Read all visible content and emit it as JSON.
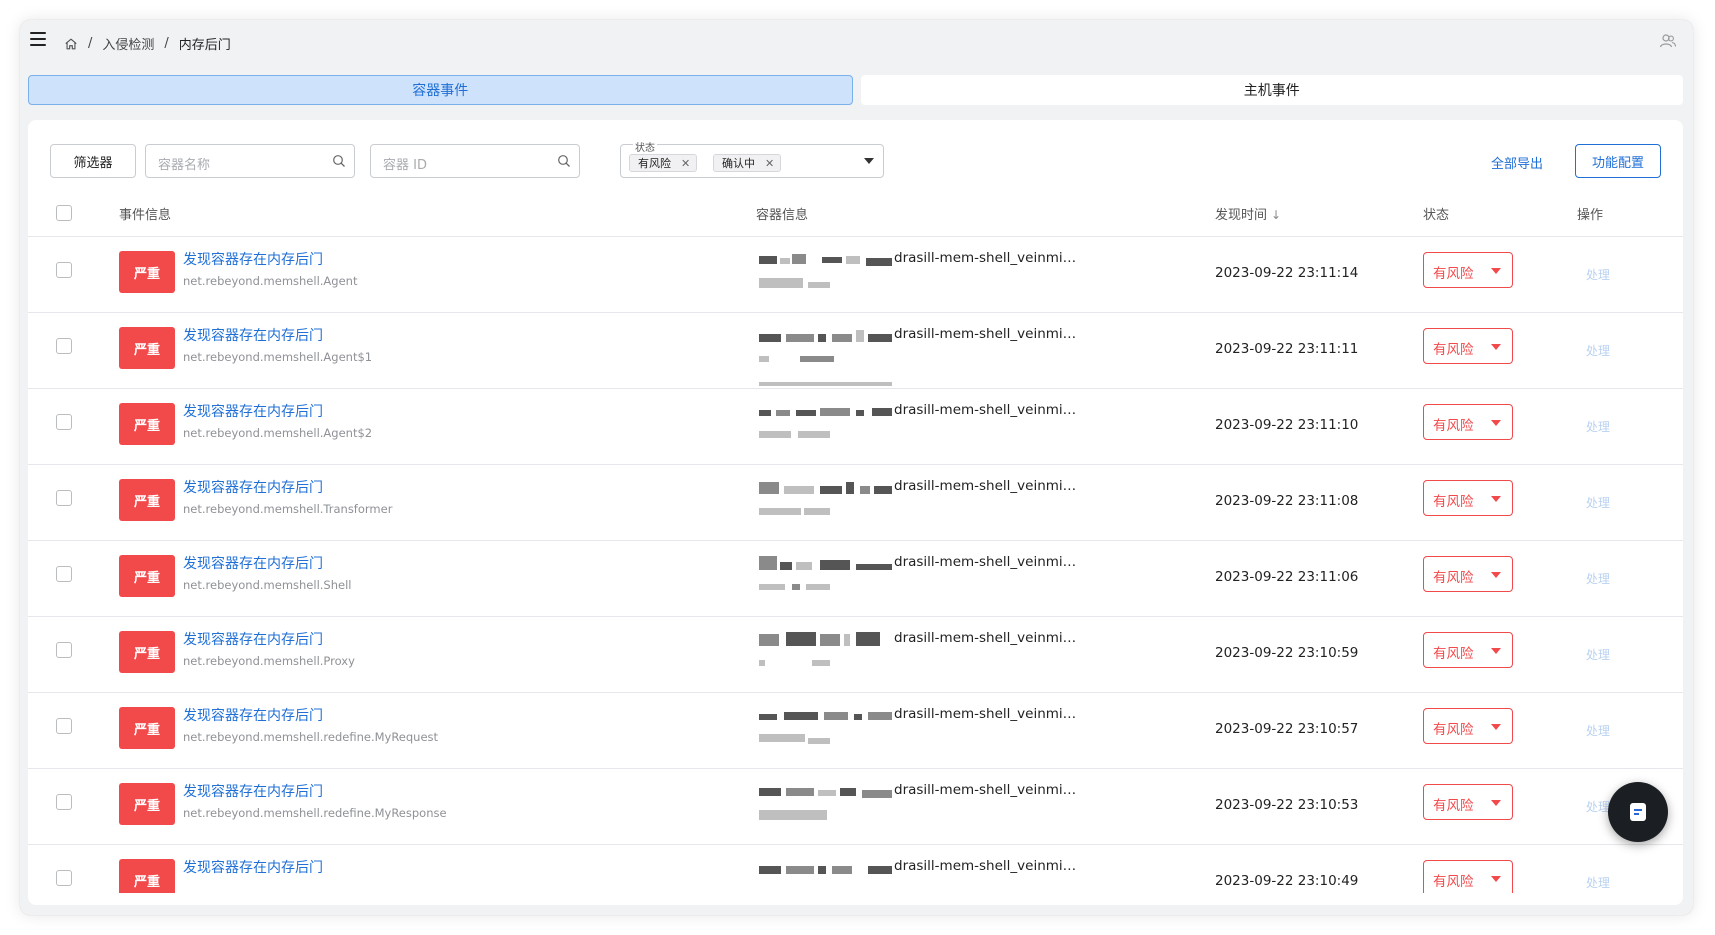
{
  "breadcrumb": {
    "items": [
      "入侵检测",
      "内存后门"
    ]
  },
  "tabs": [
    {
      "label": "容器事件",
      "active": true
    },
    {
      "label": "主机事件",
      "active": false
    }
  ],
  "toolbar": {
    "filter_label": "筛选器",
    "search_name_placeholder": "容器名称",
    "search_id_placeholder": "容器 ID",
    "status_label": "状态",
    "status_chips": [
      "有风险",
      "确认中"
    ],
    "export_label": "全部导出",
    "config_label": "功能配置"
  },
  "table": {
    "headers": {
      "event": "事件信息",
      "container": "容器信息",
      "time": "发现时间",
      "status": "状态",
      "action": "操作"
    },
    "rows": [
      {
        "severity": "严重",
        "title": "发现容器存在内存后门",
        "sub": "net.rebeyond.memshell.Agent",
        "container": "drasill-mem-shell_veinmi…",
        "time": "2023-09-22 23:11:14",
        "status": "有风险",
        "action": "处理"
      },
      {
        "severity": "严重",
        "title": "发现容器存在内存后门",
        "sub": "net.rebeyond.memshell.Agent$1",
        "container": "drasill-mem-shell_veinmi…",
        "time": "2023-09-22 23:11:11",
        "status": "有风险",
        "action": "处理"
      },
      {
        "severity": "严重",
        "title": "发现容器存在内存后门",
        "sub": "net.rebeyond.memshell.Agent$2",
        "container": "drasill-mem-shell_veinmi…",
        "time": "2023-09-22 23:11:10",
        "status": "有风险",
        "action": "处理"
      },
      {
        "severity": "严重",
        "title": "发现容器存在内存后门",
        "sub": "net.rebeyond.memshell.Transformer",
        "container": "drasill-mem-shell_veinmi…",
        "time": "2023-09-22 23:11:08",
        "status": "有风险",
        "action": "处理"
      },
      {
        "severity": "严重",
        "title": "发现容器存在内存后门",
        "sub": "net.rebeyond.memshell.Shell",
        "container": "drasill-mem-shell_veinmi…",
        "time": "2023-09-22 23:11:06",
        "status": "有风险",
        "action": "处理"
      },
      {
        "severity": "严重",
        "title": "发现容器存在内存后门",
        "sub": "net.rebeyond.memshell.Proxy",
        "container": "drasill-mem-shell_veinmi…",
        "time": "2023-09-22 23:10:59",
        "status": "有风险",
        "action": "处理"
      },
      {
        "severity": "严重",
        "title": "发现容器存在内存后门",
        "sub": "net.rebeyond.memshell.redefine.MyRequest",
        "container": "drasill-mem-shell_veinmi…",
        "time": "2023-09-22 23:10:57",
        "status": "有风险",
        "action": "处理"
      },
      {
        "severity": "严重",
        "title": "发现容器存在内存后门",
        "sub": "net.rebeyond.memshell.redefine.MyResponse",
        "container": "drasill-mem-shell_veinmi…",
        "time": "2023-09-22 23:10:53",
        "status": "有风险",
        "action": "处理"
      },
      {
        "severity": "严重",
        "title": "发现容器存在内存后门",
        "sub": "",
        "container": "drasill-mem-shell_veinmi…",
        "time": "2023-09-22 23:10:49",
        "status": "有风险",
        "action": "处理"
      }
    ]
  },
  "colors": {
    "accent": "#1f6fd6",
    "danger": "#f2494b",
    "tab_active_bg": "#cfe2fb"
  },
  "icons": {
    "menu": "menu-icon",
    "home": "home-icon",
    "user": "user-icon",
    "search": "search-icon",
    "float": "doc-icon"
  }
}
